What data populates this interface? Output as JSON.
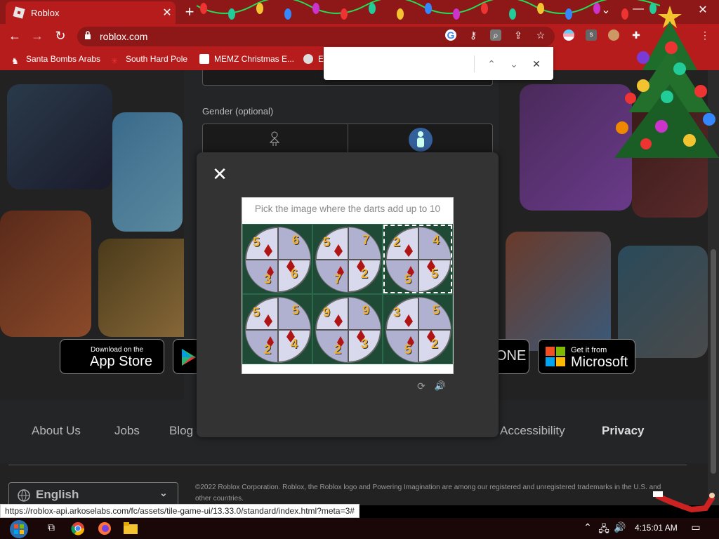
{
  "tab": {
    "title": "Roblox",
    "close": "✕",
    "new_tab": "+"
  },
  "window": {
    "minimize": "—",
    "restore": "❐",
    "close": "✕",
    "tab_search": "⌄"
  },
  "nav": {
    "back": "←",
    "forward": "→",
    "reload": "↻",
    "url": "roblox.com",
    "menu": "⋮"
  },
  "bookmarks": [
    {
      "label": "Santa Bombs Arabs"
    },
    {
      "label": "South Hard Pole"
    },
    {
      "label": "MEMZ Christmas E..."
    },
    {
      "label": "E"
    }
  ],
  "find_bar": {
    "value": "",
    "prev": "⌃",
    "next": "⌄",
    "close": "✕"
  },
  "page": {
    "gender_label": "Gender (optional)",
    "store_buttons": [
      {
        "small": "Download on the",
        "big": "App Store"
      },
      {
        "small": "",
        "big": ""
      },
      {
        "small": "",
        "big": "ONE"
      },
      {
        "small": "Get it from",
        "big": "Microsoft"
      }
    ],
    "footer_links": [
      "About Us",
      "Jobs",
      "Blog",
      "Accessibility",
      "Privacy"
    ],
    "language": "English",
    "copyright": "©2022 Roblox Corporation. Roblox, the Roblox logo and Powering Imagination are among our registered and unregistered trademarks in the U.S. and other countries."
  },
  "modal": {
    "close": "✕",
    "prompt": "Pick the image where the darts add up to 10",
    "tiles": [
      {
        "numbers": [
          "5",
          "6",
          "3",
          "6"
        ],
        "selected": false
      },
      {
        "numbers": [
          "5",
          "7",
          "7",
          "2"
        ],
        "selected": false
      },
      {
        "numbers": [
          "2",
          "4",
          "5",
          "5"
        ],
        "selected": true
      },
      {
        "numbers": [
          "5",
          "5",
          "2",
          "4"
        ],
        "selected": false
      },
      {
        "numbers": [
          "9",
          "9",
          "2",
          "3"
        ],
        "selected": false
      },
      {
        "numbers": [
          "3",
          "5",
          "5",
          "2"
        ],
        "selected": false
      }
    ],
    "reload": "⟳",
    "audio": "🔊"
  },
  "status_url": "https://roblox-api.arkoselabs.com/fc/assets/tile-game-ui/13.33.0/standard/index.html?meta=3#",
  "taskbar": {
    "time": "4:15:01 AM"
  },
  "colors": {
    "tab_bar": "#8e1717",
    "toolbar": "#b71c1c",
    "modal_bg": "#333333",
    "page_bg": "#222222"
  }
}
